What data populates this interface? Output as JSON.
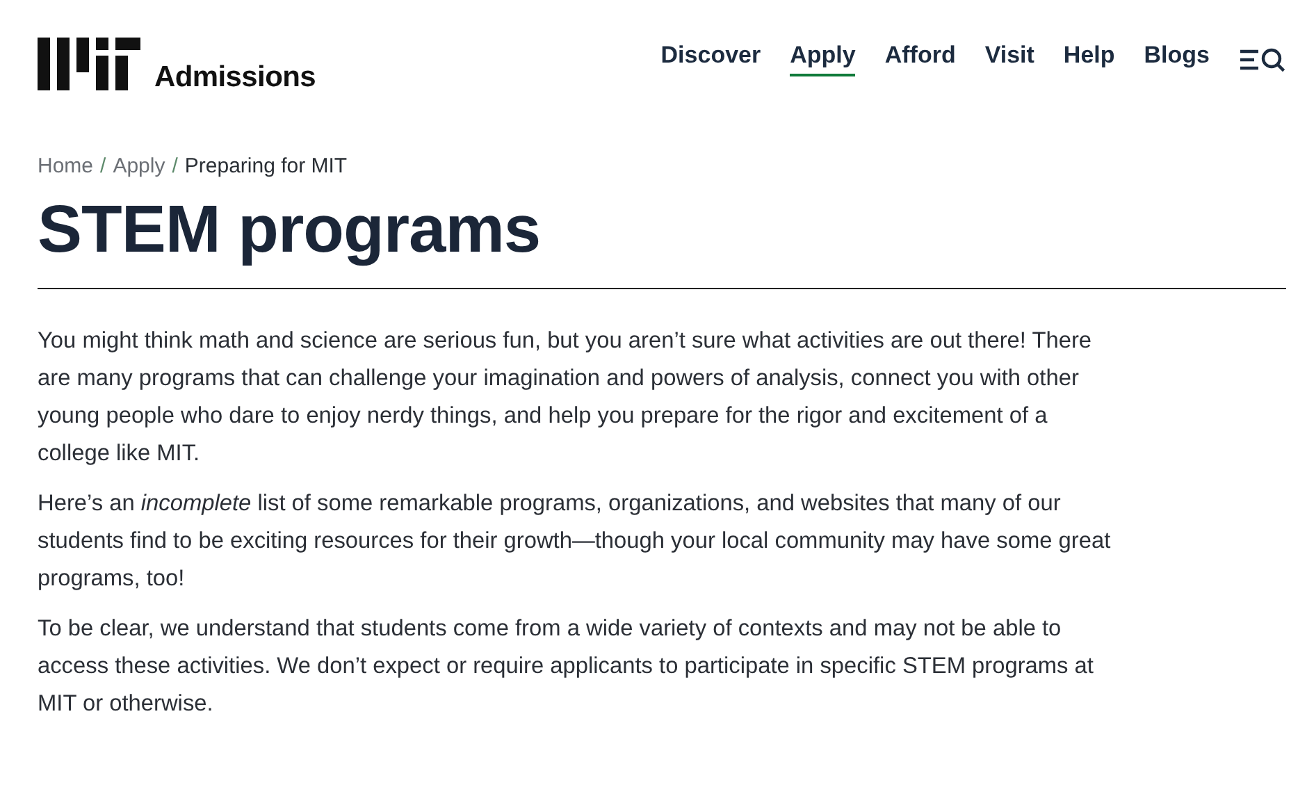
{
  "header": {
    "site_name": "Admissions",
    "nav": [
      {
        "label": "Discover",
        "selected": false
      },
      {
        "label": "Apply",
        "selected": true
      },
      {
        "label": "Afford",
        "selected": false
      },
      {
        "label": "Visit",
        "selected": false
      },
      {
        "label": "Help",
        "selected": false
      },
      {
        "label": "Blogs",
        "selected": false
      }
    ]
  },
  "breadcrumbs": {
    "separator": "/",
    "items": [
      {
        "label": "Home",
        "kind": "link"
      },
      {
        "label": "Apply",
        "kind": "link"
      },
      {
        "label": "Preparing for MIT",
        "kind": "current"
      }
    ]
  },
  "title": "STEM programs",
  "paragraphs": [
    "You might think math and science are serious fun, but you aren’t sure what activities are out there! There are many programs that can challenge your imagination and powers of analysis, connect you with other young people who dare to enjoy nerdy things, and help you prepare for the rigor and excitement of a college like MIT.",
    "Here’s an *incomplete* list of some remarkable programs, organizations, and websites that many of our students find to be exciting resources for their growth—though your local community may have some great programs, too!",
    "To be clear, we understand that students come from a wide variety of contexts and may not be able to access these activities. We don’t expect or require applicants to participate in specific STEM programs at MIT or otherwise."
  ]
}
